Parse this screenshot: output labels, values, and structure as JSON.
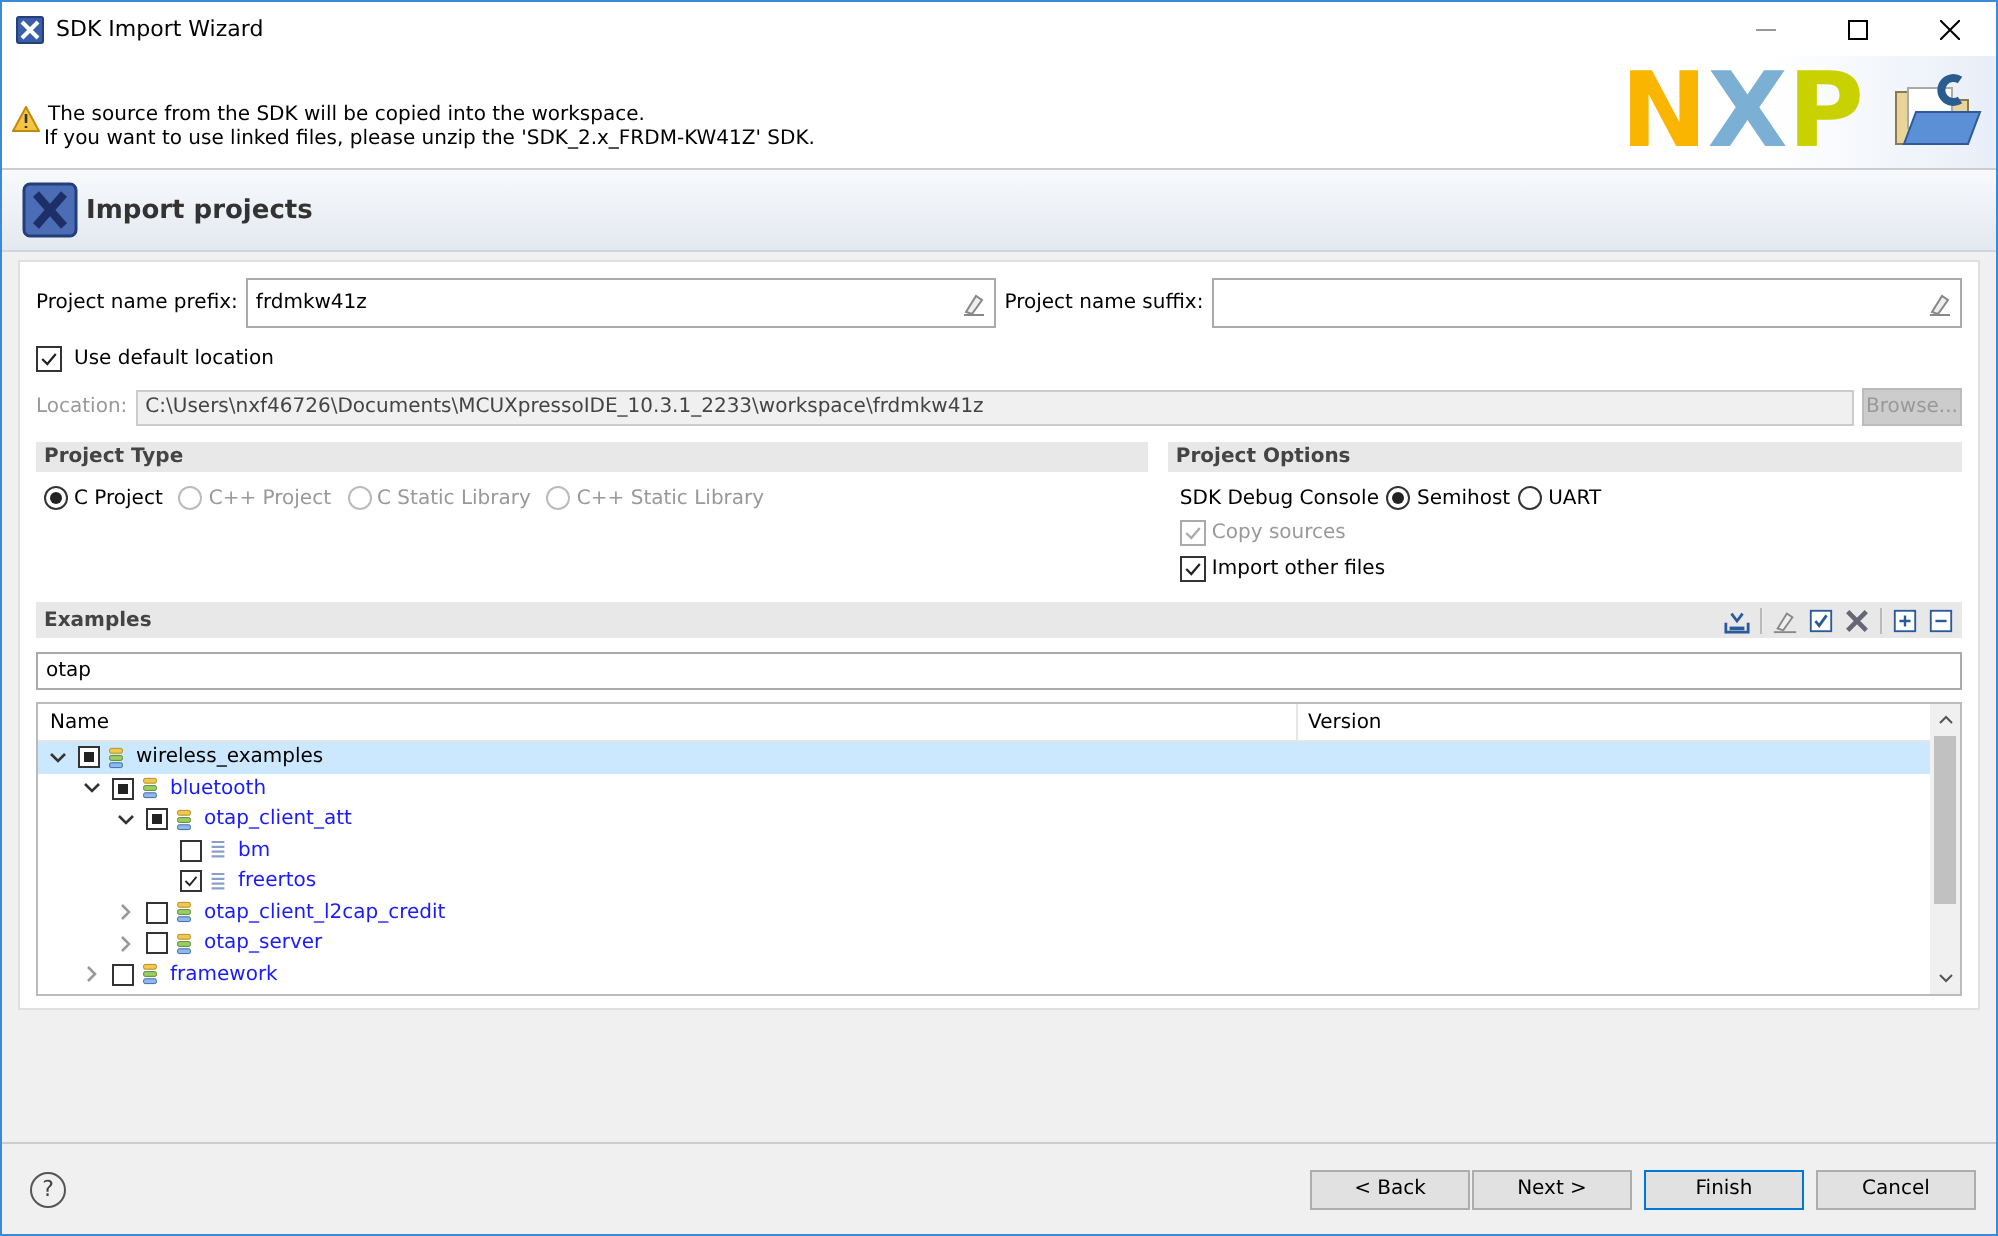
{
  "window": {
    "title": "SDK Import Wizard"
  },
  "banner": {
    "message_lines": [
      "The source from the SDK will be copied into the workspace.",
      "If you want to use linked files, please unzip the 'SDK_2.x_FRDM-KW41Z' SDK."
    ],
    "logo": "NXP"
  },
  "header": {
    "title": "Import projects"
  },
  "prefix": {
    "label": "Project name prefix:",
    "value": "frdmkw41z"
  },
  "suffix": {
    "label": "Project name suffix:"
  },
  "use_default_location": {
    "label": "Use default location",
    "checked": true
  },
  "location": {
    "label": "Location:",
    "value": "C:\\Users\\nxf46726\\Documents\\MCUXpressoIDE_10.3.1_2233\\workspace\\frdmkw41z",
    "disabled": true,
    "browse": "Browse..."
  },
  "project_type": {
    "title": "Project Type",
    "options": [
      {
        "label": "C Project",
        "selected": true,
        "disabled": false
      },
      {
        "label": "C++ Project",
        "selected": false,
        "disabled": true
      },
      {
        "label": "C Static Library",
        "selected": false,
        "disabled": true
      },
      {
        "label": "C++ Static Library",
        "selected": false,
        "disabled": true
      }
    ]
  },
  "project_options": {
    "title": "Project Options",
    "console_label": "SDK Debug Console",
    "console_options": [
      {
        "label": "Semihost",
        "selected": true
      },
      {
        "label": "UART",
        "selected": false
      }
    ],
    "checkboxes": [
      {
        "label": "Copy sources",
        "checked": true,
        "disabled": true
      },
      {
        "label": "Import other files",
        "checked": true,
        "disabled": false
      }
    ]
  },
  "examples": {
    "title": "Examples",
    "filter": "otap",
    "columns": [
      "Name",
      "Version"
    ],
    "tree": [
      {
        "name": "wireless_examples",
        "kind": "group",
        "checked": true,
        "partial": true,
        "expanded": true,
        "selected": true,
        "children": [
          {
            "name": "bluetooth",
            "kind": "group",
            "checked": true,
            "partial": true,
            "expanded": true,
            "selected": false,
            "children": [
              {
                "name": "otap_client_att",
                "kind": "group",
                "checked": true,
                "partial": true,
                "expanded": true,
                "selected": false,
                "children": [
                  {
                    "name": "bm",
                    "kind": "project",
                    "checked": false,
                    "partial": false,
                    "selected": false
                  },
                  {
                    "name": "freertos",
                    "kind": "project",
                    "checked": true,
                    "partial": false,
                    "selected": false
                  }
                ]
              },
              {
                "name": "otap_client_l2cap_credit",
                "kind": "group",
                "checked": false,
                "partial": false,
                "expanded": false,
                "selected": false
              },
              {
                "name": "otap_server",
                "kind": "group",
                "checked": false,
                "partial": false,
                "expanded": false,
                "selected": false
              }
            ]
          },
          {
            "name": "framework",
            "kind": "group",
            "checked": false,
            "partial": false,
            "expanded": false,
            "selected": false
          }
        ]
      }
    ]
  },
  "help": "?",
  "buttons": [
    {
      "label": "< Back",
      "default": false
    },
    {
      "label": "Next >",
      "default": false
    },
    {
      "label": "Finish",
      "default": true
    },
    {
      "label": "Cancel",
      "default": false
    }
  ]
}
